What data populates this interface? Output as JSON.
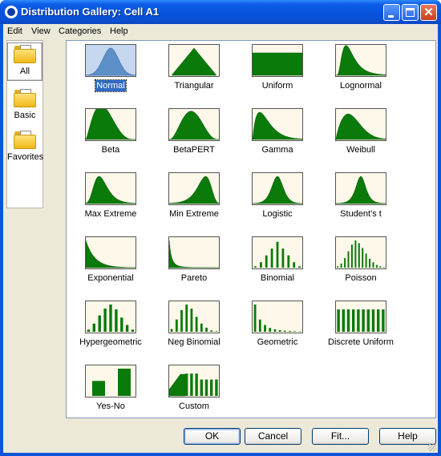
{
  "window": {
    "title": "Distribution Gallery: Cell A1",
    "controls": [
      "minimize-icon",
      "maximize-icon",
      "close-icon"
    ]
  },
  "menu": [
    "Edit",
    "View",
    "Categories",
    "Help"
  ],
  "categories": [
    {
      "label": "All",
      "icon": "folder-icon",
      "selected": true
    },
    {
      "label": "Basic",
      "icon": "folder-icon"
    },
    {
      "label": "Favorites",
      "icon": "folder-star-icon"
    }
  ],
  "distributions": [
    {
      "label": "Normal",
      "shape": "normal",
      "selected": true
    },
    {
      "label": "Triangular",
      "shape": "triangular"
    },
    {
      "label": "Uniform",
      "shape": "uniform"
    },
    {
      "label": "Lognormal",
      "shape": "lognormal"
    },
    {
      "label": "Beta",
      "shape": "beta"
    },
    {
      "label": "BetaPERT",
      "shape": "betapert"
    },
    {
      "label": "Gamma",
      "shape": "gamma"
    },
    {
      "label": "Weibull",
      "shape": "weibull"
    },
    {
      "label": "Max Extreme",
      "shape": "maxextreme"
    },
    {
      "label": "Min Extreme",
      "shape": "minextreme"
    },
    {
      "label": "Logistic",
      "shape": "logistic"
    },
    {
      "label": "Student's t",
      "shape": "studentt"
    },
    {
      "label": "Exponential",
      "shape": "exponential"
    },
    {
      "label": "Pareto",
      "shape": "pareto"
    },
    {
      "label": "Binomial",
      "shape": "binomial"
    },
    {
      "label": "Poisson",
      "shape": "poisson"
    },
    {
      "label": "Hypergeometric",
      "shape": "hypergeometric"
    },
    {
      "label": "Neg Binomial",
      "shape": "negbinomial"
    },
    {
      "label": "Geometric",
      "shape": "geometric"
    },
    {
      "label": "Discrete Uniform",
      "shape": "discreteuniform"
    },
    {
      "label": "Yes-No",
      "shape": "yesno"
    },
    {
      "label": "Custom",
      "shape": "custom"
    }
  ],
  "buttons": {
    "ok": "OK",
    "cancel": "Cancel",
    "fit": "Fit...",
    "help": "Help"
  },
  "colors": {
    "fill": "#0a7a0a",
    "selected_fill": "#5d8fc8",
    "thumb_bg": "#fdf8ea",
    "selection": "#316ac5"
  }
}
